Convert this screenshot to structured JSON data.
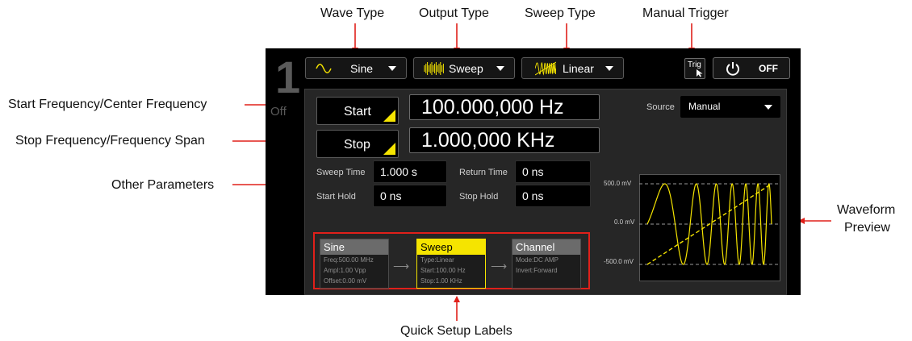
{
  "annotations": {
    "wave_type": "Wave Type",
    "output_type": "Output Type",
    "sweep_type": "Sweep Type",
    "manual_trigger": "Manual Trigger",
    "start_freq": "Start Frequency/Center Frequency",
    "stop_freq": "Stop Frequency/Frequency Span",
    "other_params": "Other Parameters",
    "waveform_preview_line1": "Waveform",
    "waveform_preview_line2": "Preview",
    "quick_setup": "Quick Setup Labels"
  },
  "channel": {
    "number": "1",
    "state": "Off"
  },
  "toolbar": {
    "wave_type": "Sine",
    "output_type": "Sweep",
    "sweep_type": "Linear",
    "trig_label": "Trig",
    "power_label": "OFF"
  },
  "params": {
    "start_label": "Start",
    "start_value": "100.000,000 Hz",
    "stop_label": "Stop",
    "stop_value": "1.000,000 KHz",
    "sweep_time_label": "Sweep Time",
    "sweep_time_value": "1.000 s",
    "return_time_label": "Return Time",
    "return_time_value": "0 ns",
    "start_hold_label": "Start Hold",
    "start_hold_value": "0 ns",
    "stop_hold_label": "Stop Hold",
    "stop_hold_value": "0 ns"
  },
  "source": {
    "label": "Source",
    "value": "Manual"
  },
  "quick_setup": {
    "sine": {
      "title": "Sine",
      "lines": [
        "Freq:500.00 MHz",
        "Ampl:1.00 Vpp",
        "Offset:0.00 mV"
      ]
    },
    "sweep": {
      "title": "Sweep",
      "lines": [
        "Type:Linear",
        "Start:100.00 Hz",
        "Stop:1.00 KHz"
      ]
    },
    "channel": {
      "title": "Channel",
      "lines": [
        "Mode:DC AMP",
        "Invert:Forward"
      ]
    }
  },
  "preview": {
    "y_top": "500.0 mV",
    "y_mid": "0.0 mV",
    "y_bottom": "-500.0 mV"
  },
  "colors": {
    "accent_yellow": "#f5e400",
    "annotation_red": "#e0201a",
    "panel_bg": "#262626"
  }
}
